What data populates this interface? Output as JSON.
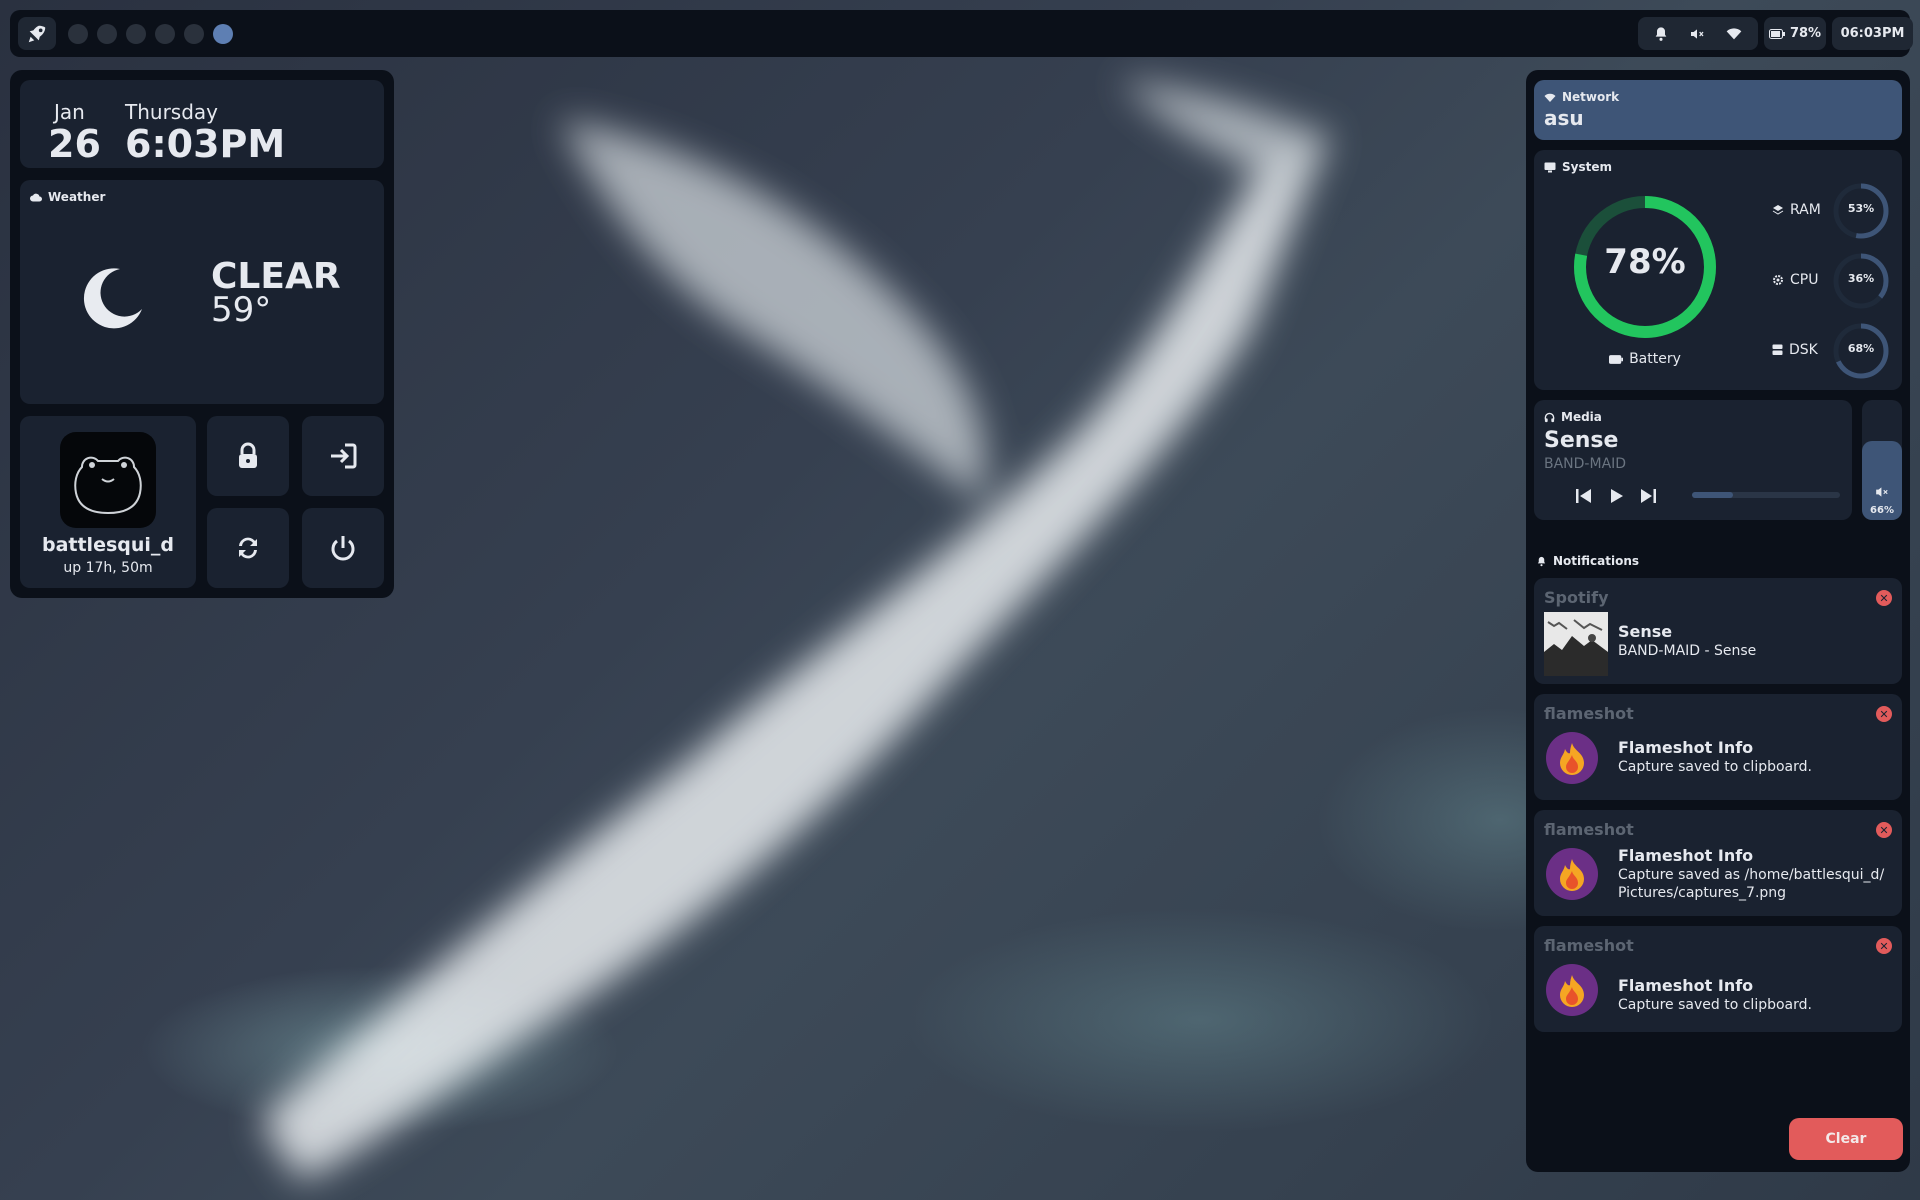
{
  "topbar": {
    "workspaces": [
      1,
      2,
      3,
      4,
      5,
      6
    ],
    "active_workspace": 6,
    "battery": "78%",
    "clock": "06:03PM"
  },
  "datecard": {
    "month": "Jan",
    "day": "26",
    "weekday": "Thursday",
    "time": "6:03PM"
  },
  "weather": {
    "heading": "Weather",
    "condition": "CLEAR",
    "temperature": "59°"
  },
  "user": {
    "name": "battlesqui_d",
    "uptime": "up 17h, 50m"
  },
  "network": {
    "heading": "Network",
    "ssid": "asu"
  },
  "system": {
    "heading": "System",
    "battery_percent": 78,
    "battery_label": "78%",
    "battery_caption": "Battery",
    "stats": [
      {
        "name": "RAM",
        "value": 53,
        "label": "53%"
      },
      {
        "name": "CPU",
        "value": 36,
        "label": "36%"
      },
      {
        "name": "DSK",
        "value": 68,
        "label": "68%"
      }
    ]
  },
  "media": {
    "heading": "Media",
    "title": "Sense",
    "artist": "BAND-MAID",
    "progress": 0.28,
    "volume": 66,
    "volume_label": "66%"
  },
  "notifications": {
    "heading": "Notifications",
    "items": [
      {
        "source": "Spotify",
        "title": "Sense",
        "body": "BAND-MAID - Sense"
      },
      {
        "source": "flameshot",
        "title": "Flameshot Info",
        "body": "Capture saved to clipboard."
      },
      {
        "source": "flameshot",
        "title": "Flameshot Info",
        "body": "Capture saved as /home/battlesqui_d/Pictures/captures_7.png"
      },
      {
        "source": "flameshot",
        "title": "Flameshot Info",
        "body": "Capture saved to clipboard."
      }
    ],
    "clear_label": "Clear"
  },
  "colors": {
    "accent": "#3e5577",
    "battery_ring": "#22c55e",
    "danger": "#e25b5b",
    "panel": "#0b1019",
    "card": "#1a2230"
  }
}
